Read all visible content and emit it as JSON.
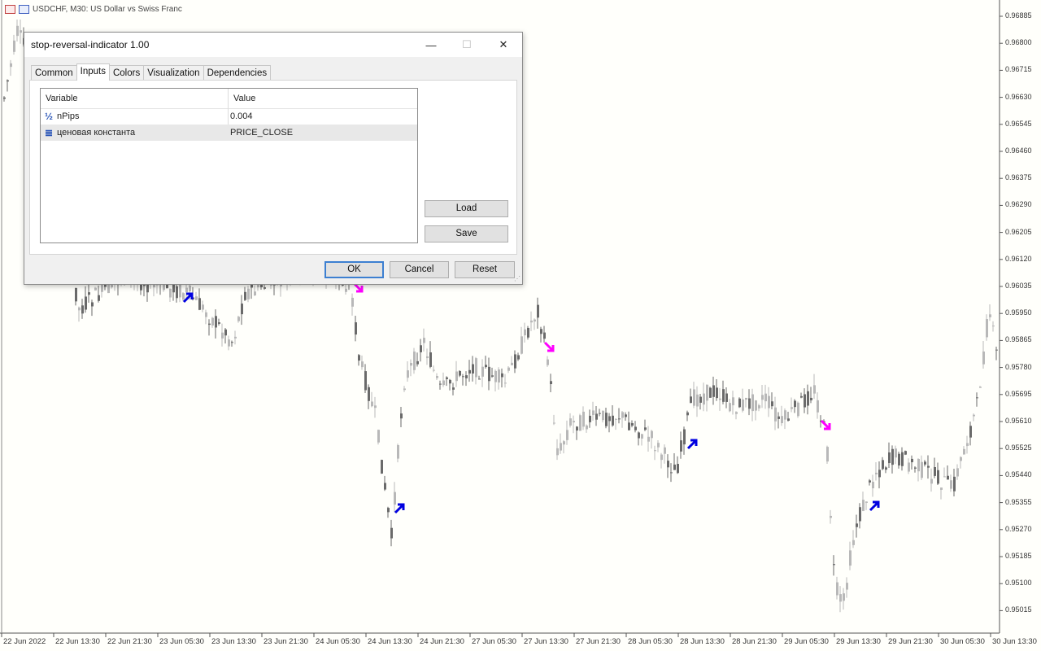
{
  "chart": {
    "symbol_title": "USDCHF, M30:  US Dollar vs Swiss Franc",
    "price_labels": [
      "0.96885",
      "0.96800",
      "0.96715",
      "0.96630",
      "0.96545",
      "0.96460",
      "0.96375",
      "0.96290",
      "0.96205",
      "0.96120",
      "0.96035",
      "0.95950",
      "0.95865",
      "0.95780",
      "0.95695",
      "0.95610",
      "0.95525",
      "0.95440",
      "0.95355",
      "0.95270",
      "0.95185",
      "0.95100",
      "0.95015"
    ],
    "time_labels": [
      "22 Jun 2022",
      "22 Jun 13:30",
      "22 Jun 21:30",
      "23 Jun 05:30",
      "23 Jun 13:30",
      "23 Jun 21:30",
      "24 Jun 05:30",
      "24 Jun 13:30",
      "24 Jun 21:30",
      "27 Jun 05:30",
      "27 Jun 13:30",
      "27 Jun 21:30",
      "28 Jun 05:30",
      "28 Jun 13:30",
      "28 Jun 21:30",
      "29 Jun 05:30",
      "29 Jun 13:30",
      "29 Jun 21:30",
      "30 Jun 05:30",
      "30 Jun 13:30"
    ],
    "colors": {
      "bull": "#b8b8b8",
      "bear": "#6a6a6a",
      "up_arrow": "#0000e0",
      "down_arrow": "#ff00ff"
    }
  },
  "dialog": {
    "title": "stop-reversal-indicator 1.00",
    "window_buttons": {
      "minimize": "—",
      "maximize": "☐",
      "close": "✕"
    },
    "tabs": [
      "Common",
      "Inputs",
      "Colors",
      "Visualization",
      "Dependencies"
    ],
    "active_tab": "Inputs",
    "grid": {
      "headers": {
        "variable": "Variable",
        "value": "Value"
      },
      "rows": [
        {
          "icon": "fraction-icon",
          "icon_glyph": "½",
          "variable": "nPips",
          "value": "0.004"
        },
        {
          "icon": "enum-list-icon",
          "icon_glyph": "≣",
          "variable": "ценовая константа",
          "value": "PRICE_CLOSE"
        }
      ]
    },
    "side_buttons": {
      "load": "Load",
      "save": "Save"
    },
    "footer_buttons": {
      "ok": "OK",
      "cancel": "Cancel",
      "reset": "Reset"
    }
  }
}
